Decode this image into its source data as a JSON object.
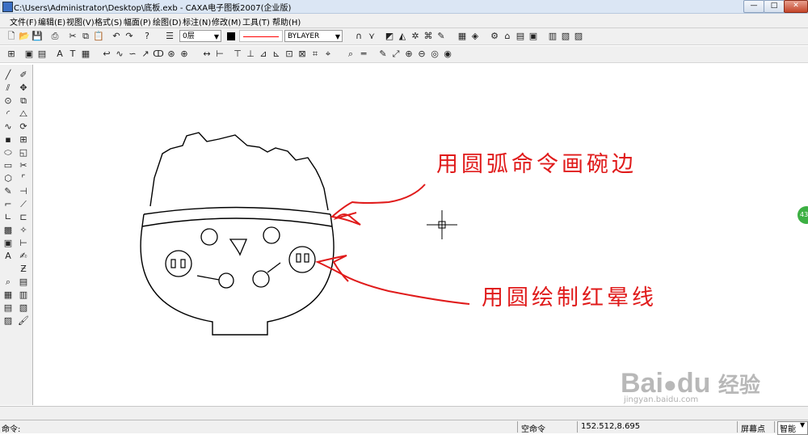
{
  "window": {
    "title": "C:\\Users\\Administrator\\Desktop\\底板.exb - CAXA电子图板2007(企业版)",
    "min_label": "—",
    "max_label": "□",
    "close_label": "✕"
  },
  "menu": [
    "文件(F)",
    "编辑(E)",
    "视图(V)",
    "格式(S)",
    "幅面(P)",
    "绘图(D)",
    "标注(N)",
    "修改(M)",
    "工具(T)",
    "帮助(H)"
  ],
  "toolbar": {
    "layer_value": "0层",
    "linetype_value": "BYLAYER",
    "color_hex": "#000000",
    "line_color_hex": "#ff0000"
  },
  "annotations": {
    "bowl_edge": "用圆弧命令画碗边",
    "blush_lines": "用圆绘制红晕线"
  },
  "status": {
    "command_label": "命令:",
    "empty_command": "空命令",
    "coordinates": "152.512,8.695",
    "snap_mode": "屏幕点",
    "smart_mode": "智能"
  },
  "watermark": {
    "brand": "Bai",
    "brand2": "du",
    "cn": "经验",
    "url": "jingyan.baidu.com"
  },
  "side_badge": "43",
  "colors": {
    "accent_red": "#e01b1b",
    "badge_green": "#3cb043"
  }
}
